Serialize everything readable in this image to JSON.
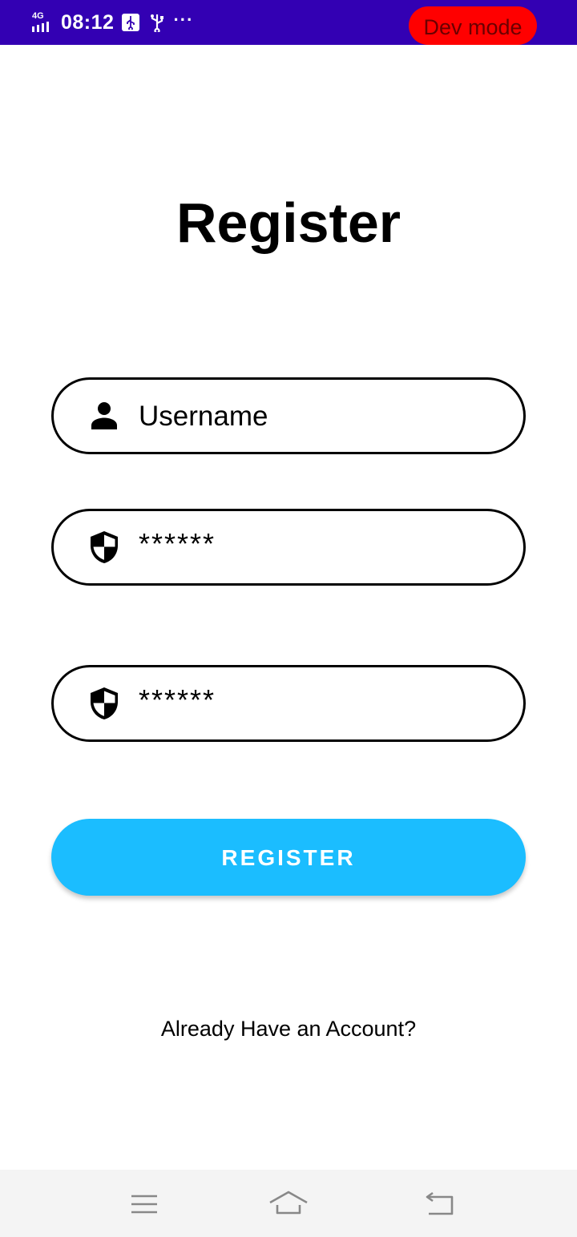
{
  "status_bar": {
    "network": "4G",
    "time": "08:12",
    "more": "···",
    "dev_badge": "Dev mode",
    "icons": [
      "signal-icon",
      "usb-debug-icon",
      "usb-icon",
      "more-icon"
    ]
  },
  "colors": {
    "status_bar_bg": "#3300b3",
    "dev_badge_bg": "#ff0000",
    "button_bg": "#1bbdff",
    "field_border": "#000000",
    "nav_bar_bg": "#f4f4f4"
  },
  "page": {
    "title": "Register"
  },
  "form": {
    "username": {
      "placeholder": "Username",
      "icon": "person-icon"
    },
    "password": {
      "value": "******",
      "icon": "shield-icon"
    },
    "confirm_password": {
      "value": "******",
      "icon": "shield-icon"
    },
    "submit_label": "REGISTER"
  },
  "footer": {
    "login_link": "Already Have an Account?"
  },
  "nav_bar": {
    "icons": [
      "menu-icon",
      "home-icon",
      "back-icon"
    ]
  }
}
